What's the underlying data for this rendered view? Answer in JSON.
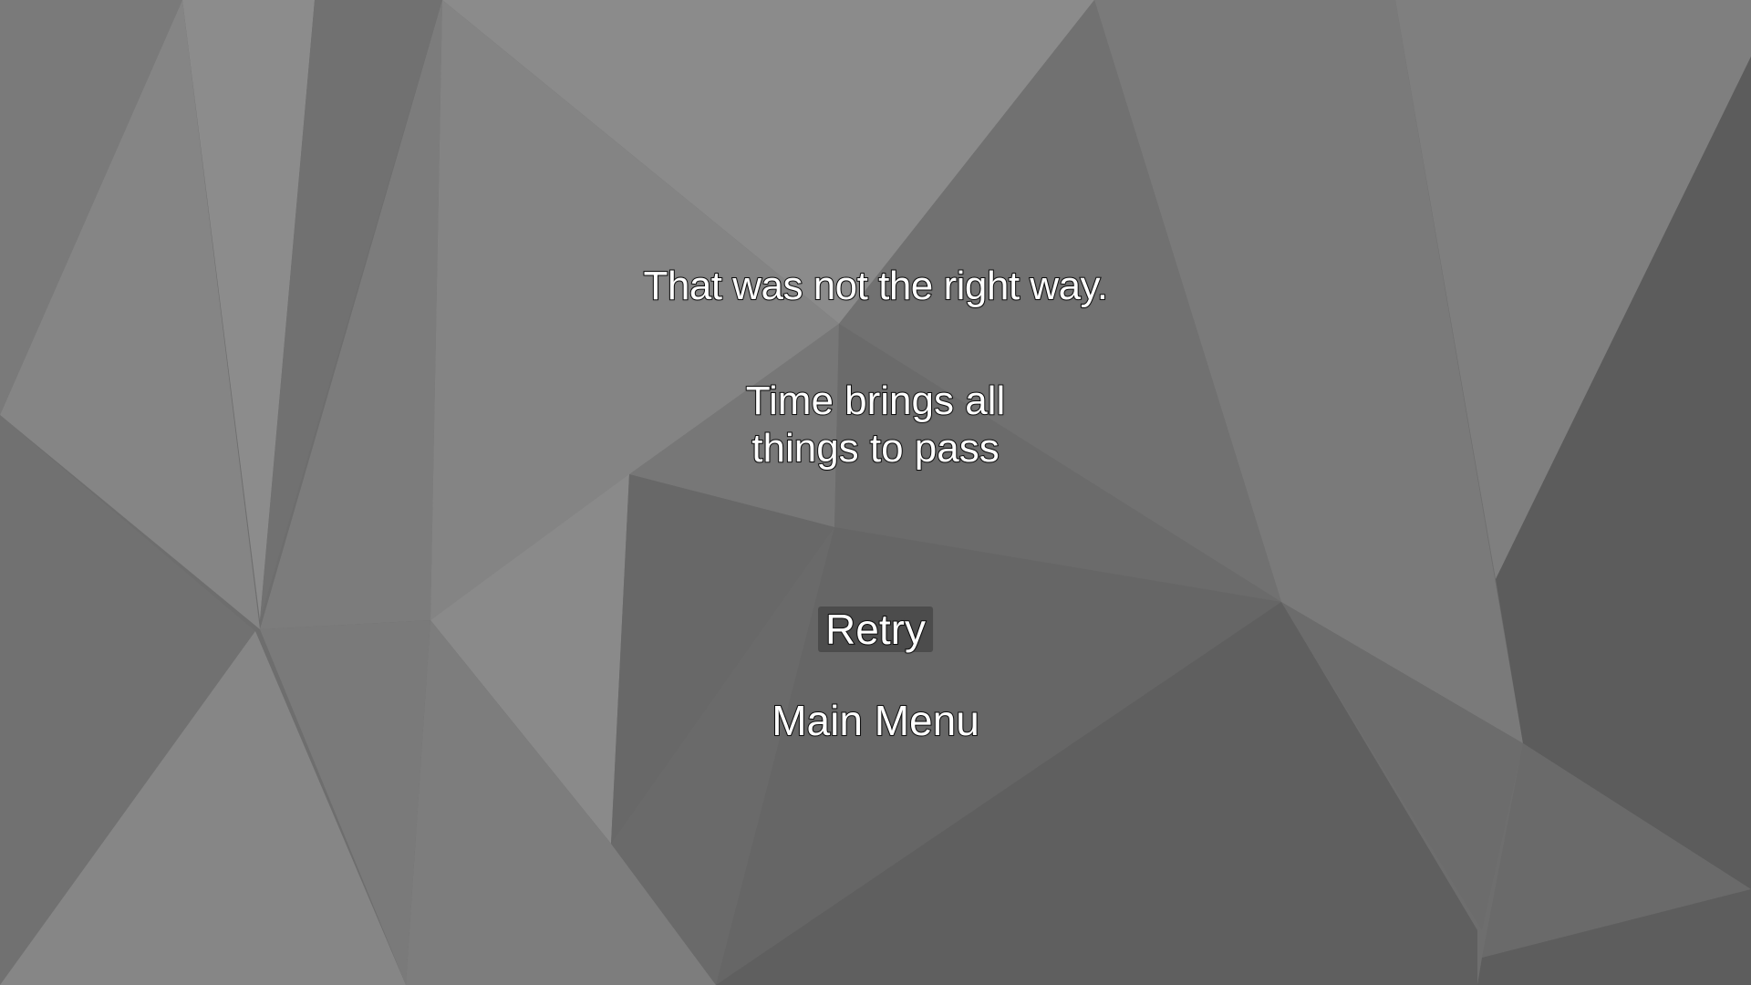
{
  "game_over": {
    "message": "That was not the right way.",
    "quote_line_1": "Time brings all",
    "quote_line_2": "things to pass"
  },
  "menu": {
    "retry_label": "Retry",
    "main_menu_label": "Main Menu",
    "selected_item": "Retry"
  },
  "colors": {
    "text": "#ffffff",
    "text_outline": "#111111",
    "selected_highlight": "#4c4c4c"
  }
}
